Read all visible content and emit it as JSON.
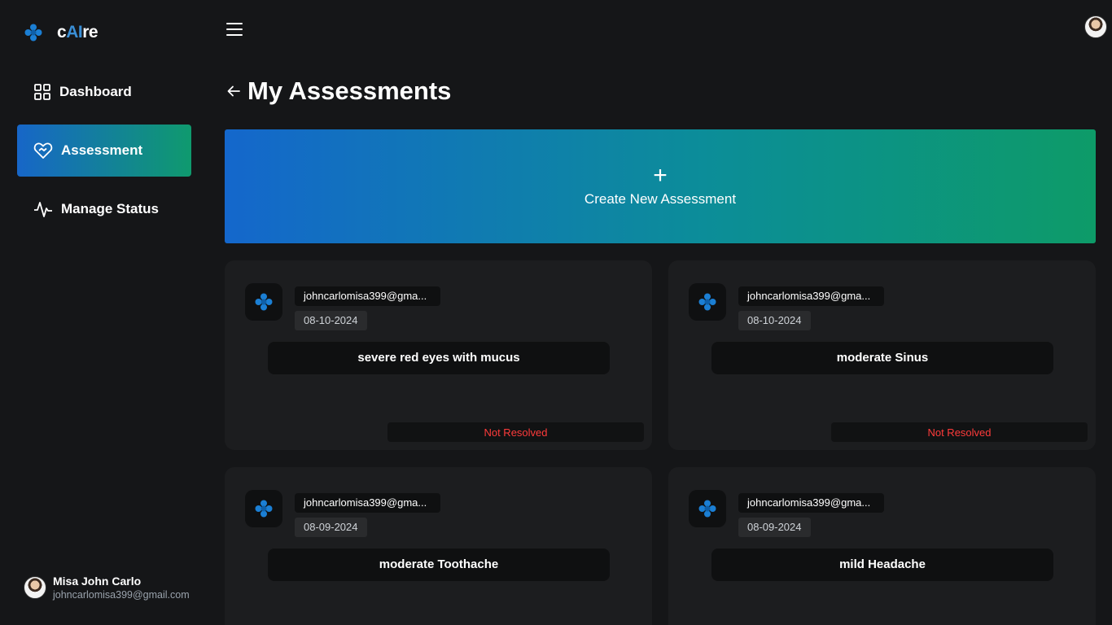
{
  "brand": {
    "name_prefix": "c",
    "name_ai": "AI",
    "name_suffix": "re"
  },
  "sidebar": {
    "items": [
      {
        "label": "Dashboard",
        "icon": "grid-icon",
        "active": false
      },
      {
        "label": "Assessment",
        "icon": "heart-hand-icon",
        "active": true
      },
      {
        "label": "Manage Status",
        "icon": "pulse-icon",
        "active": false
      }
    ]
  },
  "user": {
    "name": "Misa John Carlo",
    "email": "johncarlomisa399@gmail.com"
  },
  "page": {
    "title": "My Assessments"
  },
  "create": {
    "plus": "+",
    "label": "Create New Assessment"
  },
  "assessments": [
    {
      "email": "johncarlomisa399@gma...",
      "date": "08-10-2024",
      "condition": "severe red eyes with mucus",
      "status": "Not Resolved"
    },
    {
      "email": "johncarlomisa399@gma...",
      "date": "08-10-2024",
      "condition": "moderate Sinus",
      "status": "Not Resolved"
    },
    {
      "email": "johncarlomisa399@gma...",
      "date": "08-09-2024",
      "condition": "moderate Toothache",
      "status": ""
    },
    {
      "email": "johncarlomisa399@gma...",
      "date": "08-09-2024",
      "condition": "mild Headache",
      "status": ""
    }
  ],
  "colors": {
    "accent_blue": "#1766c8",
    "accent_green": "#0f9a6e",
    "status_red": "#ff3b3b",
    "logo_blue": "#1b7fd4"
  }
}
